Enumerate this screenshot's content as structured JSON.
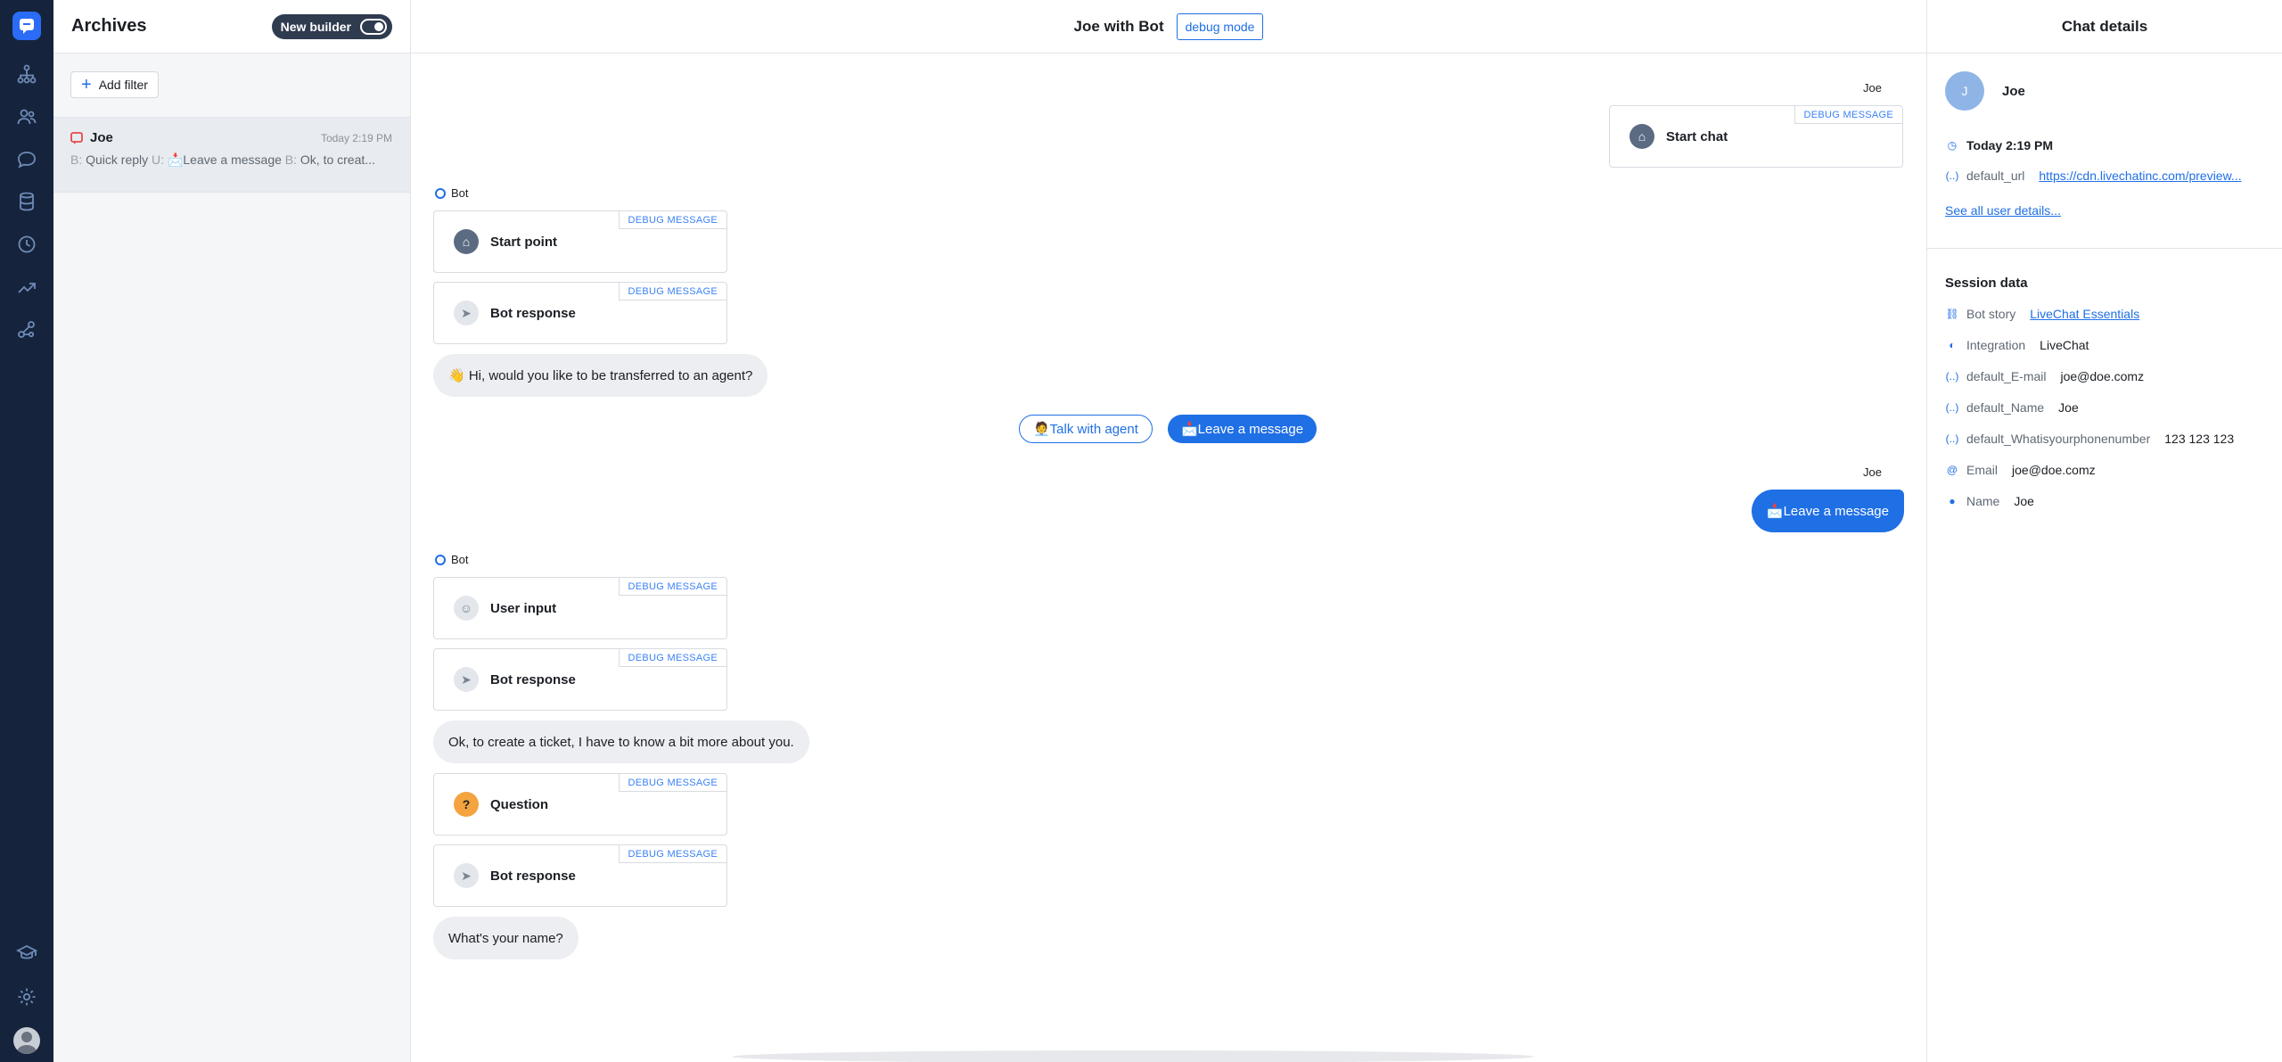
{
  "colors": {
    "rail": "#15243c",
    "accent": "#1f6fe5",
    "bot_bubble": "#eceef1",
    "selected_item": "#e8ebef"
  },
  "rail": {
    "icons": [
      "chat-logo-icon",
      "bot-structure-icon",
      "contacts-icon",
      "chats-icon",
      "database-icon",
      "history-icon",
      "reports-icon",
      "integrations-icon",
      "academy-icon",
      "settings-icon",
      "avatar"
    ]
  },
  "archives": {
    "title": "Archives",
    "new_builder_label": "New builder",
    "add_filter_label": "Add filter",
    "items": [
      {
        "name": "Joe",
        "time": "Today 2:19 PM",
        "preview": [
          {
            "prefix": "B:",
            "text": "Quick reply"
          },
          {
            "prefix": "U:",
            "text": "📩Leave a message"
          },
          {
            "prefix": "B:",
            "text": "Ok, to creat..."
          }
        ]
      }
    ]
  },
  "main": {
    "title": "Joe with Bot",
    "debug_mode_label": "debug mode",
    "debug_tag": "DEBUG MESSAGE",
    "user_sender": "Joe",
    "bot_sender": "Bot",
    "messages": {
      "start_chat": "Start chat",
      "start_point": "Start point",
      "bot_response_1": "Bot response",
      "greeting": "👋 Hi, would you like to be transferred to an agent?",
      "quick_reply_1": "🧑‍💼Talk with agent",
      "quick_reply_2": "📩Leave a message",
      "user_reply": "📩Leave a message",
      "user_input": "User input",
      "bot_response_2": "Bot response",
      "ticket_text": "Ok, to create a ticket, I have to know a bit more about you.",
      "question": "Question",
      "bot_response_3": "Bot response",
      "name_question": "What's your name?"
    }
  },
  "details": {
    "title": "Chat details",
    "avatar_initial": "J",
    "user_name": "Joe",
    "time": "Today 2:19 PM",
    "url_key": "default_url",
    "url_value": "https://cdn.livechatinc.com/preview...",
    "see_all_label": "See all user details...",
    "session_title": "Session data",
    "session": [
      {
        "icon": "bot-story-icon",
        "key": "Bot story",
        "value": "LiveChat Essentials",
        "link": true
      },
      {
        "icon": "integration-icon",
        "key": "Integration",
        "value": "LiveChat",
        "link": false
      },
      {
        "icon": "variable-icon",
        "key": "default_E-mail",
        "value": "joe@doe.comz",
        "link": false
      },
      {
        "icon": "variable-icon",
        "key": "default_Name",
        "value": "Joe",
        "link": false
      },
      {
        "icon": "variable-icon",
        "key": "default_Whatisyourphonenumber",
        "value": "123 123 123",
        "link": false
      },
      {
        "icon": "at-icon",
        "key": "Email",
        "value": "joe@doe.comz",
        "link": false
      },
      {
        "icon": "person-icon",
        "key": "Name",
        "value": "Joe",
        "link": false
      }
    ]
  }
}
